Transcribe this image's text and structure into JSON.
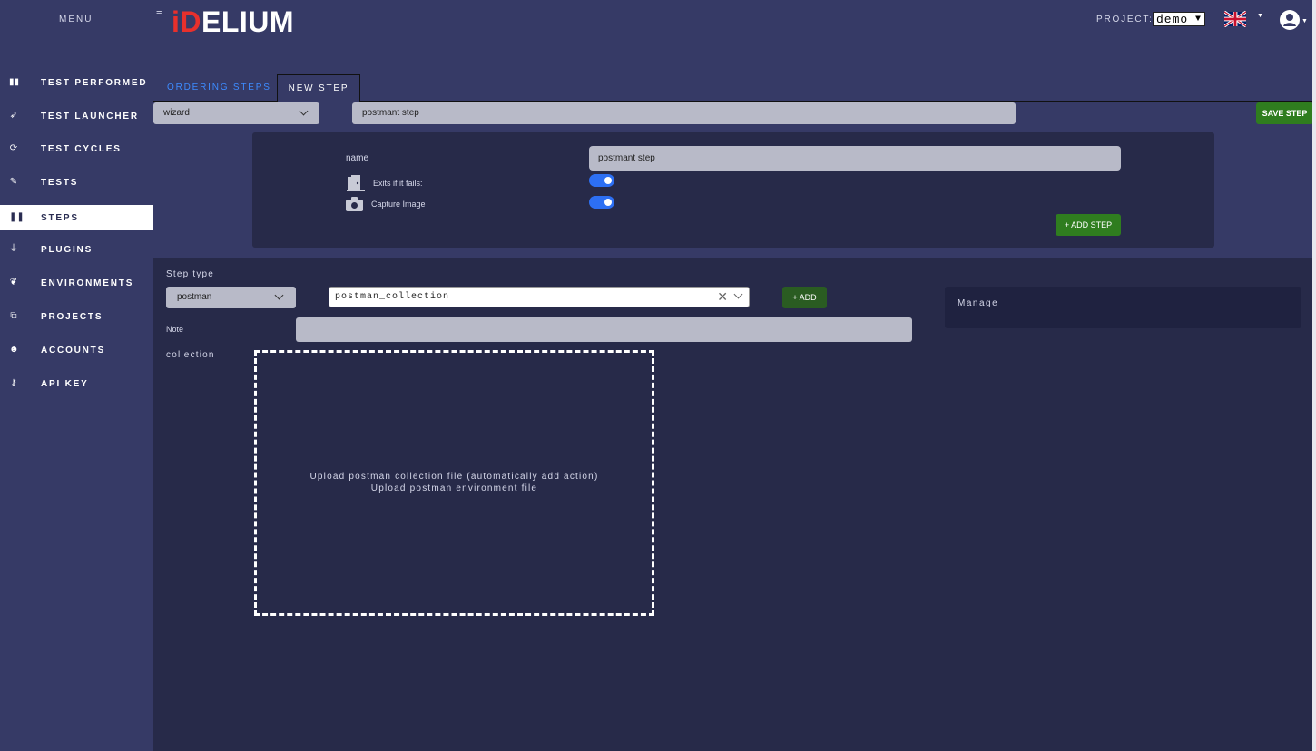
{
  "sidebar": {
    "menu_label": "MENU",
    "items": [
      {
        "label": "TEST PERFORMED",
        "icon": "clipboard-icon",
        "glyph": "▮▮",
        "active": false
      },
      {
        "label": "TEST LAUNCHER",
        "icon": "rocket-icon",
        "glyph": "➶",
        "active": false
      },
      {
        "label": "TEST CYCLES",
        "icon": "sync-icon",
        "glyph": "⟳",
        "active": false
      },
      {
        "label": "TESTS",
        "icon": "pencil-icon",
        "glyph": "✎",
        "active": false
      },
      {
        "label": "STEPS",
        "icon": "footsteps-icon",
        "glyph": "❚❚",
        "active": true
      },
      {
        "label": "PLUGINS",
        "icon": "plug-icon",
        "glyph": "⏚",
        "active": false
      },
      {
        "label": "ENVIRONMENTS",
        "icon": "leaf-icon",
        "glyph": "❦",
        "active": false
      },
      {
        "label": "PROJECTS",
        "icon": "sitemap-icon",
        "glyph": "⧉",
        "active": false
      },
      {
        "label": "ACCOUNTS",
        "icon": "users-icon",
        "glyph": "☻",
        "active": false
      },
      {
        "label": "API KEY",
        "icon": "key-icon",
        "glyph": "⚷",
        "active": false
      }
    ]
  },
  "header": {
    "hamburger": "≡",
    "logo_red": "iD",
    "logo_white": "ELIUM",
    "project_label": "PROJECT:",
    "project_value": "demo",
    "flag_icon": "uk-flag-icon",
    "user_icon": "user-circle-icon"
  },
  "tabs": {
    "ordering_label": "ORDERING STEPS",
    "new_label": "NEW STEP"
  },
  "toolbar": {
    "mode_value": "wizard",
    "step_title_value": "postmant step",
    "save_label": "SAVE STEP"
  },
  "props": {
    "name_label": "name",
    "name_value": "postmant step",
    "exit_label": "Exits if it fails:",
    "capture_label": "Capture Image",
    "exit_enabled": true,
    "capture_enabled": true,
    "add_step_label": "+ ADD STEP"
  },
  "step_config": {
    "step_type_label": "Step type",
    "step_type_value": "postman",
    "action_value": "postman_collection",
    "clear_glyph": "✕",
    "add_label": "+ ADD",
    "manage_label": "Manage",
    "note_label": "Note",
    "note_value": "",
    "collection_label": "collection",
    "drop_line1": "Upload postman collection file (automatically add action)",
    "drop_line2": "Upload postman environment file"
  },
  "colors": {
    "background": "#363a66",
    "panel": "#272a49",
    "accent_green": "#2f7d1f",
    "tab_blue": "#3d8bff",
    "toggle_blue": "#2d6ff3",
    "logo_red": "#e8302c"
  }
}
